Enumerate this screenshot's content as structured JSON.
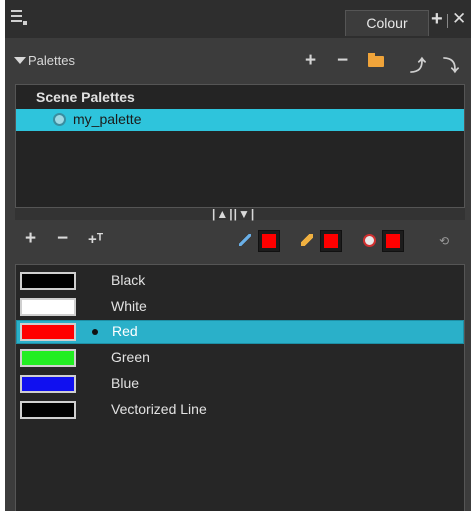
{
  "titlebar": {
    "tab_label": "Colour",
    "plus_glyph": "+",
    "close_glyph": "✕"
  },
  "palettes": {
    "header_label": "Palettes",
    "add_glyph": "+",
    "remove_glyph": "−",
    "up_glyph": "⤴",
    "down_glyph": "⤵",
    "group_label": "Scene Palettes",
    "items": [
      {
        "label": "my_palette",
        "selected": true
      }
    ]
  },
  "splitter": {
    "handle_glyph": "|▲||▼|"
  },
  "colour_toolbar": {
    "add_glyph": "+",
    "remove_glyph": "−",
    "texture_glyph": "+ᵀ",
    "current_colours": {
      "brush": "#ff0000",
      "pencil": "#ff0000",
      "paint": "#ff0000"
    },
    "link_glyph": "⟲"
  },
  "colours": [
    {
      "name": "Black",
      "swatch": "#000000",
      "selected": false
    },
    {
      "name": "White",
      "swatch": "#ffffff",
      "selected": false
    },
    {
      "name": "Red",
      "swatch": "#ff0000",
      "selected": true
    },
    {
      "name": "Green",
      "swatch": "#22ee22",
      "selected": false
    },
    {
      "name": "Blue",
      "swatch": "#1010f0",
      "selected": false
    },
    {
      "name": "Vectorized Line",
      "swatch": "#000000",
      "selected": false
    }
  ],
  "accent_colors": {
    "selection": "#2ec4dc",
    "panel": "#3c3c3c"
  }
}
